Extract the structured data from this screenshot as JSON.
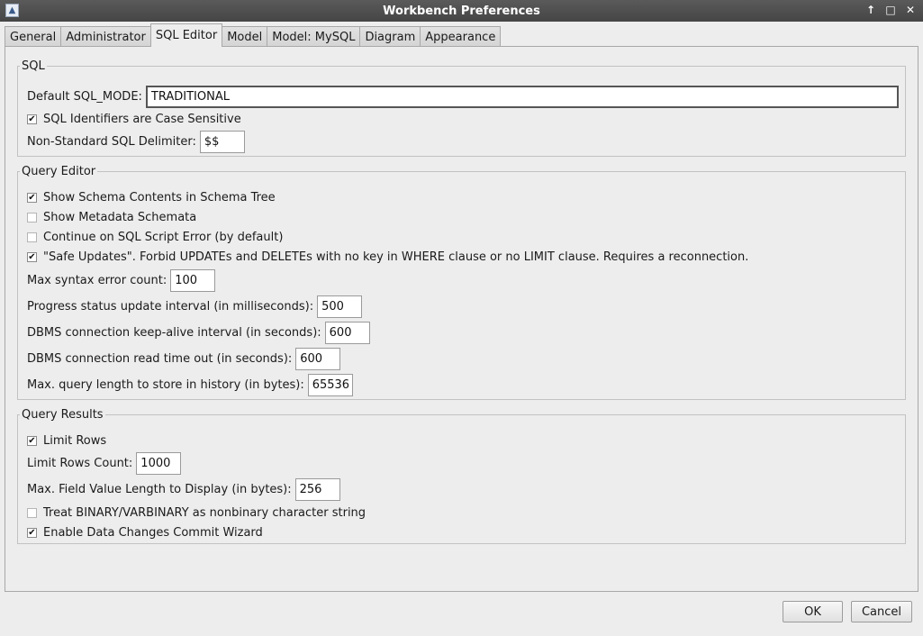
{
  "window": {
    "title": "Workbench Preferences",
    "controls": [
      "↑",
      "□",
      "✕"
    ]
  },
  "tabs": [
    "General",
    "Administrator",
    "SQL Editor",
    "Model",
    "Model: MySQL",
    "Diagram",
    "Appearance"
  ],
  "active_tab": "SQL Editor",
  "sql": {
    "legend": "SQL",
    "sql_mode_label": "Default SQL_MODE:",
    "sql_mode_value": "TRADITIONAL",
    "case_sensitive_label": "SQL Identifiers are Case Sensitive",
    "case_sensitive_checked": true,
    "delimiter_label": "Non-Standard SQL Delimiter:",
    "delimiter_value": "$$"
  },
  "query_editor": {
    "legend": "Query Editor",
    "show_schema_label": "Show Schema Contents in Schema Tree",
    "show_schema_checked": true,
    "show_metadata_label": "Show Metadata Schemata",
    "show_metadata_checked": false,
    "continue_on_error_label": "Continue on SQL Script Error (by default)",
    "continue_on_error_checked": false,
    "safe_updates_label": "\"Safe Updates\". Forbid UPDATEs and DELETEs with no key in WHERE clause or no LIMIT clause. Requires a reconnection.",
    "safe_updates_checked": true,
    "max_syntax_label": "Max syntax error count:",
    "max_syntax_value": "100",
    "progress_label": "Progress status update interval (in milliseconds):",
    "progress_value": "500",
    "keepalive_label": "DBMS connection keep-alive interval (in seconds):",
    "keepalive_value": "600",
    "read_timeout_label": "DBMS connection read time out (in seconds):",
    "read_timeout_value": "600",
    "max_query_label": "Max. query length to store in history (in bytes):",
    "max_query_value": "65536"
  },
  "query_results": {
    "legend": "Query Results",
    "limit_rows_label": "Limit Rows",
    "limit_rows_checked": true,
    "limit_count_label": "Limit Rows Count:",
    "limit_count_value": "1000",
    "max_field_label": "Max. Field Value Length to Display (in bytes):",
    "max_field_value": "256",
    "binary_label": "Treat BINARY/VARBINARY as nonbinary character string",
    "binary_checked": false,
    "commit_wizard_label": "Enable Data Changes Commit Wizard",
    "commit_wizard_checked": true
  },
  "buttons": {
    "ok": "OK",
    "cancel": "Cancel"
  },
  "check_glyph": "✔"
}
